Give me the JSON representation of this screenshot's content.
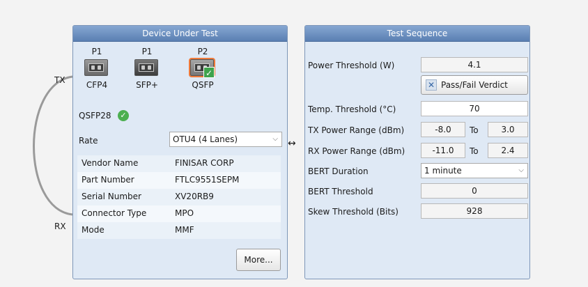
{
  "dut_panel": {
    "title": "Device Under Test",
    "ports": [
      {
        "label": "P1",
        "name": "CFP4"
      },
      {
        "label": "P1",
        "name": "SFP+"
      },
      {
        "label": "P2",
        "name": "QSFP"
      }
    ],
    "detected_module": "QSFP28",
    "rate": {
      "label": "Rate",
      "value": "OTU4 (4 Lanes)"
    },
    "info": [
      {
        "key": "Vendor Name",
        "value": "FINISAR CORP"
      },
      {
        "key": "Part Number",
        "value": "FTLC9551SEPM"
      },
      {
        "key": "Serial Number",
        "value": "XV20RB9"
      },
      {
        "key": "Connector Type",
        "value": "MPO"
      },
      {
        "key": "Mode",
        "value": "MMF"
      }
    ],
    "more_button": "More..."
  },
  "loop": {
    "tx": "TX",
    "rx": "RX"
  },
  "link_arrow": "↔",
  "test_panel": {
    "title": "Test Sequence",
    "power_threshold": {
      "label": "Power Threshold (W)",
      "value": "4.1"
    },
    "verdict_button": "Pass/Fail Verdict",
    "temp_threshold": {
      "label": "Temp. Threshold (°C)",
      "value": "70"
    },
    "tx_power_range": {
      "label": "TX Power Range (dBm)",
      "min": "-8.0",
      "to": "To",
      "max": "3.0"
    },
    "rx_power_range": {
      "label": "RX Power Range (dBm)",
      "min": "-11.0",
      "to": "To",
      "max": "2.4"
    },
    "bert_duration": {
      "label": "BERT Duration",
      "value": "1 minute"
    },
    "bert_threshold": {
      "label": "BERT Threshold",
      "value": "0"
    },
    "skew_threshold": {
      "label": "Skew Threshold (Bits)",
      "value": "928"
    }
  },
  "colors": {
    "header": "#5a7fb2",
    "panel_bg": "#dfe9f5",
    "check": "#4caf50",
    "selected_border": "#f07a3a"
  }
}
